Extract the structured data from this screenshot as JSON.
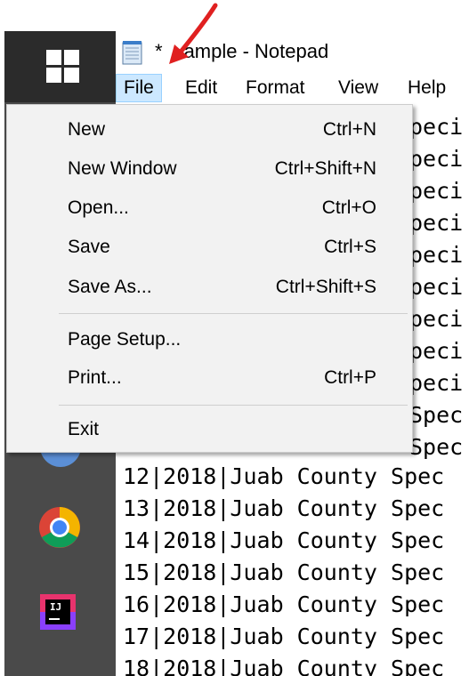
{
  "window": {
    "title": "*example - Notepad",
    "title_visible_prefix": "*",
    "title_visible_suffix": "ample - Notepad"
  },
  "menubar": {
    "items": [
      {
        "label": "File",
        "active": true
      },
      {
        "label": "Edit"
      },
      {
        "label": "Format"
      },
      {
        "label": "View"
      },
      {
        "label": "Help"
      }
    ]
  },
  "file_menu": {
    "items": [
      {
        "label": "New",
        "shortcut": "Ctrl+N"
      },
      {
        "label": "New Window",
        "shortcut": "Ctrl+Shift+N"
      },
      {
        "label": "Open...",
        "shortcut": "Ctrl+O"
      },
      {
        "label": "Save",
        "shortcut": "Ctrl+S"
      },
      {
        "label": "Save As...",
        "shortcut": "Ctrl+Shift+S"
      },
      {
        "label": "Page Setup...",
        "shortcut": ""
      },
      {
        "label": "Print...",
        "shortcut": "Ctrl+P"
      },
      {
        "label": "Exit",
        "shortcut": ""
      }
    ]
  },
  "editor": {
    "behind_menu_lines": [
      "peci",
      "peci",
      "peci",
      "peci",
      "peci",
      "peci",
      "peci",
      "peci",
      "peci",
      "Spec",
      "Spec"
    ],
    "lines": [
      "12|2018|Juab County Spec",
      "13|2018|Juab County Spec",
      "14|2018|Juab County Spec",
      "15|2018|Juab County Spec",
      "16|2018|Juab County Spec",
      "17|2018|Juab County Spec",
      "18|2018|Juab County Spec"
    ]
  },
  "taskbar": {
    "icons": [
      "windows-start-icon",
      "chrome-icon",
      "intellij-icon"
    ],
    "intellij_label": "IJ"
  },
  "colors": {
    "taskbar": "#4a4a4a",
    "start_button": "#2b2b2b",
    "menu_highlight": "#cce8ff",
    "annotation_arrow": "#e02020"
  }
}
